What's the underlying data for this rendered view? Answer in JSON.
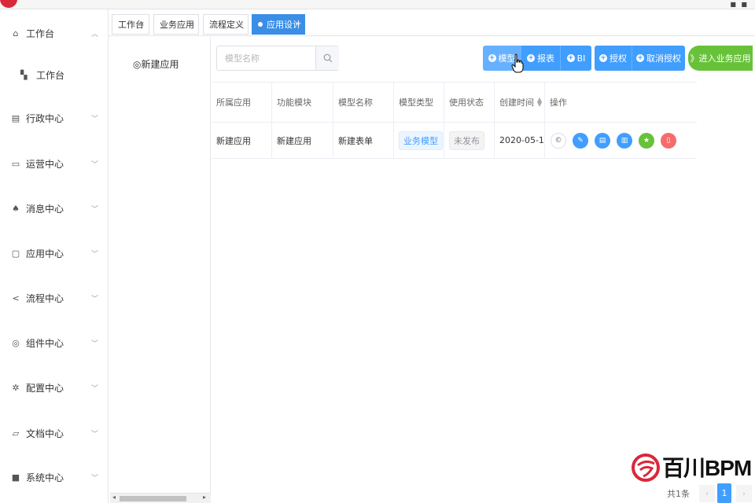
{
  "sidebar": {
    "items": [
      {
        "label": "工作台",
        "icon": "home-icon",
        "expanded": true
      },
      {
        "label": "工作台",
        "icon": "grid-icon",
        "sub": true
      },
      {
        "label": "行政中心",
        "icon": "building-icon"
      },
      {
        "label": "运营中心",
        "icon": "monitor-icon"
      },
      {
        "label": "消息中心",
        "icon": "bell-icon"
      },
      {
        "label": "应用中心",
        "icon": "chip-icon"
      },
      {
        "label": "流程中心",
        "icon": "share-icon"
      },
      {
        "label": "组件中心",
        "icon": "component-icon"
      },
      {
        "label": "配置中心",
        "icon": "gear-icon"
      },
      {
        "label": "文档中心",
        "icon": "folder-icon"
      },
      {
        "label": "系统中心",
        "icon": "system-icon"
      }
    ]
  },
  "tabs": [
    {
      "label": "工作台",
      "close": "×"
    },
    {
      "label": "业务应用",
      "close": "×"
    },
    {
      "label": "流程定义",
      "close": "×"
    },
    {
      "label": "应用设计",
      "close": "×",
      "active": true
    }
  ],
  "app_panel": {
    "new_app_label": "◎新建应用"
  },
  "search": {
    "placeholder": "模型名称"
  },
  "toolbar": {
    "model_label": "模型",
    "report_label": "报表",
    "bi_label": "BI",
    "grant_label": "授权",
    "revoke_label": "取消授权",
    "enter_label": "》进入业务应用"
  },
  "table": {
    "headers": [
      "所属应用",
      "功能模块",
      "模型名称",
      "模型类型",
      "使用状态",
      "创建时间",
      "操作"
    ],
    "rows": [
      {
        "app": "新建应用",
        "module": "新建应用",
        "model_name": "新建表单",
        "model_type": "业务模型",
        "status": "未发布",
        "created": "2020-05-1..."
      }
    ]
  },
  "logo": {
    "text": "百川BPM"
  },
  "pagination": {
    "total": "共1条",
    "current": "1",
    "prev": "‹",
    "next": "›"
  },
  "colors": {
    "primary": "#409eff",
    "success": "#67c23a",
    "danger": "#f56c6c",
    "brand": "#d9283a"
  }
}
